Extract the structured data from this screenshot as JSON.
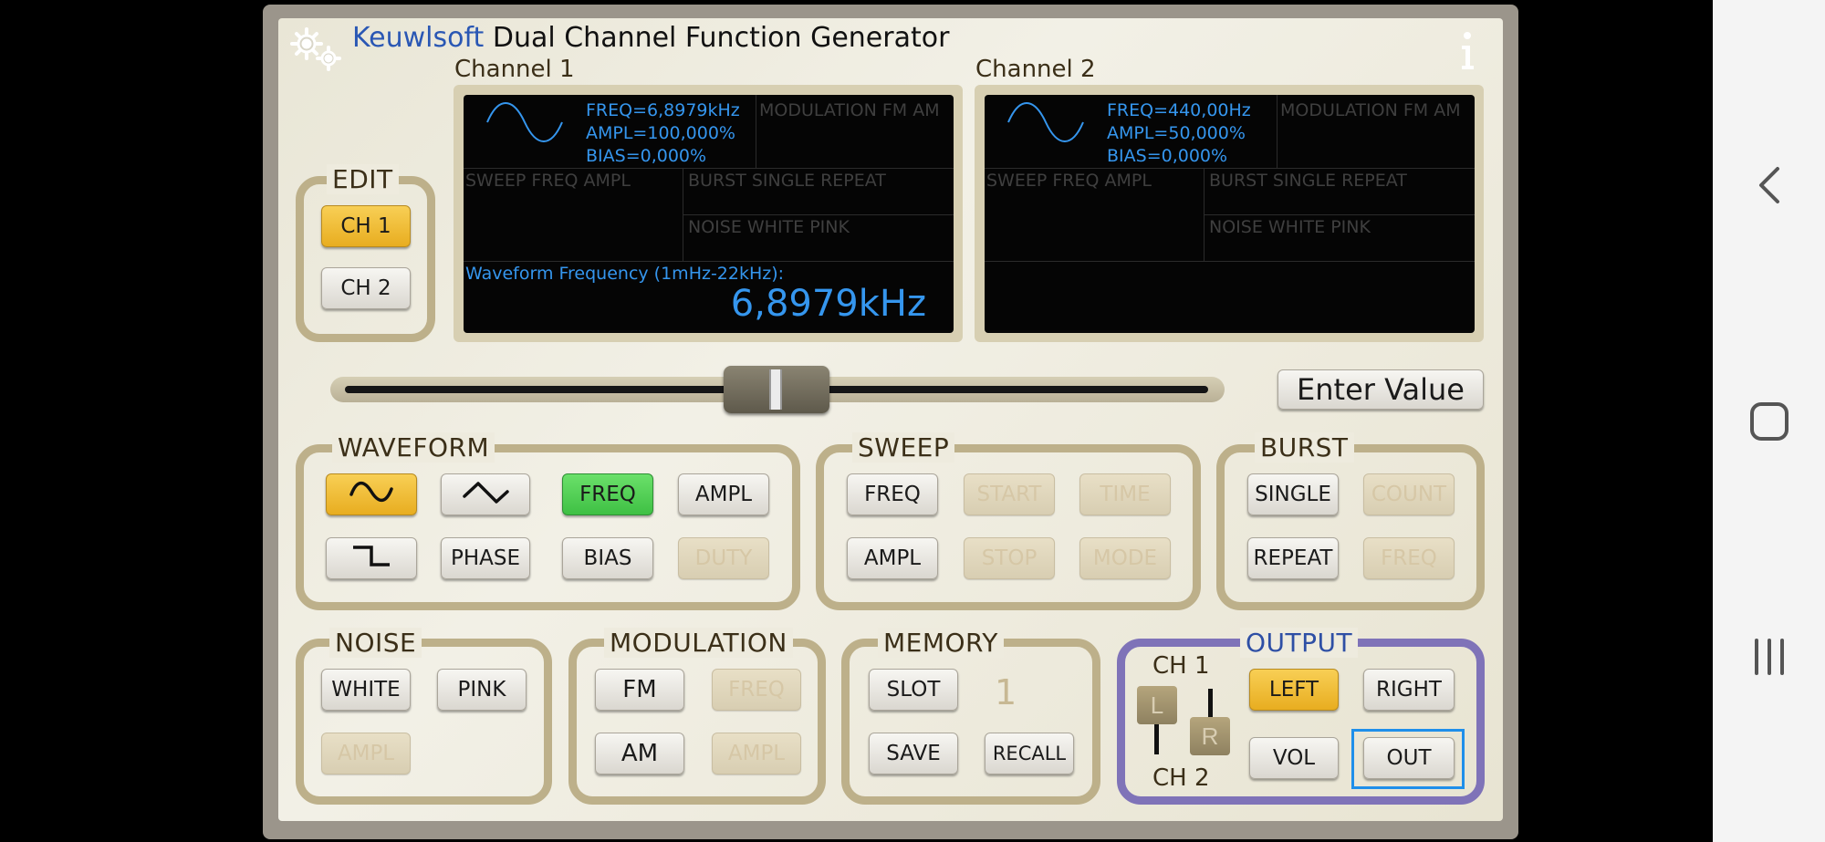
{
  "app": {
    "brand": "Keuwlsoft",
    "title": "Dual Channel Function Generator",
    "colors": {
      "brand": "#2a57b4",
      "accent_yellow": "#f2bb38",
      "accent_green": "#4fd252",
      "lcd_blue": "#3596ee",
      "output_border": "#7f73b8",
      "focus": "#1f8fea"
    }
  },
  "icons": {
    "settings": "gear-icon",
    "info": "info-icon"
  },
  "channel1": {
    "label": "Channel 1",
    "wave_icon": "sine-wave-icon",
    "freq": "FREQ=6,8979kHz",
    "ampl": "AMPL=100,000%",
    "bias": "BIAS=0,000%",
    "mod_header": "MODULATION  FM  AM",
    "sweep_header": "SWEEP   FREQ  AMPL",
    "burst_header": "BURST   SINGLE  REPEAT",
    "noise_header": "NOISE   WHITE   PINK",
    "edit_caption": "Waveform Frequency (1mHz-22kHz):",
    "edit_value": "6,8979kHz"
  },
  "channel2": {
    "label": "Channel 2",
    "wave_icon": "sine-wave-icon",
    "freq": "FREQ=440,00Hz",
    "ampl": "AMPL=50,000%",
    "bias": "BIAS=0,000%",
    "mod_header": "MODULATION  FM  AM",
    "sweep_header": "SWEEP   FREQ  AMPL",
    "burst_header": "BURST   SINGLE  REPEAT",
    "noise_header": "NOISE   WHITE   PINK"
  },
  "edit": {
    "label": "EDIT",
    "ch1": "CH 1",
    "ch2": "CH 2",
    "selected": "CH 1"
  },
  "slider": {
    "position": 0.5
  },
  "enter_value": "Enter Value",
  "waveform": {
    "label": "WAVEFORM",
    "sine_icon": "sine-wave-icon",
    "triangle_icon": "triangle-wave-icon",
    "square_icon": "square-wave-icon",
    "freq": "FREQ",
    "ampl": "AMPL",
    "phase": "PHASE",
    "bias": "BIAS",
    "duty": "DUTY"
  },
  "sweep": {
    "label": "SWEEP",
    "freq": "FREQ",
    "start": "START",
    "time": "TIME",
    "ampl": "AMPL",
    "stop": "STOP",
    "mode": "MODE"
  },
  "burst": {
    "label": "BURST",
    "single": "SINGLE",
    "count": "COUNT",
    "repeat": "REPEAT",
    "freq": "FREQ"
  },
  "noise": {
    "label": "NOISE",
    "white": "WHITE",
    "pink": "PINK",
    "ampl": "AMPL"
  },
  "modulation": {
    "label": "MODULATION",
    "fm": "FM",
    "freq": "FREQ",
    "am": "AM",
    "ampl": "AMPL"
  },
  "memory": {
    "label": "MEMORY",
    "slot": "SLOT",
    "slot_value": "1",
    "save": "SAVE",
    "recall": "RECALL"
  },
  "output": {
    "label": "OUTPUT",
    "ch1": "CH 1",
    "ch2": "CH 2",
    "fader_l": "L",
    "fader_r": "R",
    "left": "LEFT",
    "right": "RIGHT",
    "vol": "VOL",
    "out": "OUT"
  },
  "navbar": {
    "back": "back-icon",
    "home": "home-icon",
    "recents": "recents-icon"
  }
}
